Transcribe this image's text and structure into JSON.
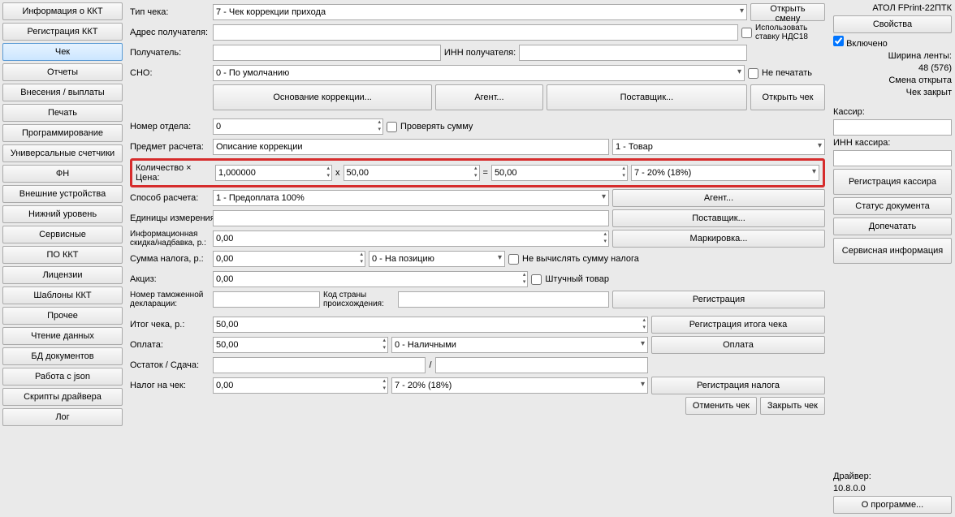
{
  "sidebar": [
    "Информация о ККТ",
    "Регистрация ККТ",
    "Чек",
    "Отчеты",
    "Внесения / выплаты",
    "Печать",
    "Программирование",
    "Универсальные счетчики",
    "ФН",
    "Внешние устройства",
    "Нижний уровень",
    "Сервисные",
    "ПО ККТ",
    "Лицензии",
    "Шаблоны ККТ",
    "Прочее",
    "Чтение данных",
    "БД документов",
    "Работа с json",
    "Скрипты драйвера",
    "Лог"
  ],
  "activeSidebar": 2,
  "f": {
    "checkTypeLbl": "Тип чека:",
    "checkType": "7 - Чек коррекции прихода",
    "openShift": "Открыть смену",
    "recipientAddrLbl": "Адрес получателя:",
    "useNds18": "Использовать ставку НДС18",
    "recipientLbl": "Получатель:",
    "innRecipientLbl": "ИНН получателя:",
    "snoLbl": "СНО:",
    "sno": "0 - По умолчанию",
    "noPrint": "Не печатать",
    "correctionBasis": "Основание коррекции...",
    "agent": "Агент...",
    "supplier": "Поставщик...",
    "openCheck": "Открыть чек",
    "deptLbl": "Номер отдела:",
    "dept": "0",
    "checkSum": "Проверять сумму",
    "subjectLbl": "Предмет расчета:",
    "subjectDesc": "Описание коррекции",
    "subjectType": "1 - Товар",
    "qtyPriceLbl": "Количество × Цена:",
    "qty": "1,000000",
    "x": "x",
    "price": "50,00",
    "eq": "=",
    "sum": "50,00",
    "vat": "7 - 20% (18%)",
    "paymentMethodLbl": "Способ расчета:",
    "paymentMethod": "1 - Предоплата 100%",
    "agentBtn": "Агент...",
    "unitsLbl": "Единицы измерения:",
    "supplierBtn": "Поставщик...",
    "infoDiscountLbl": "Информационная скидка/надбавка, р.:",
    "infoDiscount": "0,00",
    "marking": "Маркировка...",
    "taxSumLbl": "Сумма налога, р.:",
    "taxSum": "0,00",
    "taxPos": "0 - На позицию",
    "noCalcTax": "Не вычислять сумму налога",
    "exciseLbl": "Акциз:",
    "excise": "0,00",
    "pieceGoods": "Штучный товар",
    "customsDeclLbl": "Номер таможенной декларации:",
    "countryCodeLbl": "Код страны происхождения:",
    "registration": "Регистрация",
    "totalLbl": "Итог чека, р.:",
    "total": "50,00",
    "registerTotal": "Регистрация итога чека",
    "paymentLbl": "Оплата:",
    "payment": "50,00",
    "paymentType": "0 - Наличными",
    "paymentBtn": "Оплата",
    "remainderLbl": "Остаток / Сдача:",
    "slash": "/",
    "taxOnCheckLbl": "Налог на чек:",
    "taxOnCheck": "0,00",
    "taxOnCheckRate": "7 - 20% (18%)",
    "registerTax": "Регистрация налога",
    "cancelCheck": "Отменить чек",
    "closeCheck": "Закрыть чек"
  },
  "right": {
    "device": "АТОЛ FPrint-22ПТК",
    "properties": "Свойства",
    "enabled": "Включено",
    "tapeWidthLbl": "Ширина ленты:",
    "tapeWidth": "48 (576)",
    "shiftOpen": "Смена открыта",
    "checkClosed": "Чек закрыт",
    "cashierLbl": "Кассир:",
    "cashierInnLbl": "ИНН кассира:",
    "registerCashier": "Регистрация кассира",
    "docStatus": "Статус документа",
    "reprint": "Допечатать",
    "serviceInfo": "Сервисная информация",
    "driverLbl": "Драйвер:",
    "driverVer": "10.8.0.0",
    "about": "О программе..."
  }
}
